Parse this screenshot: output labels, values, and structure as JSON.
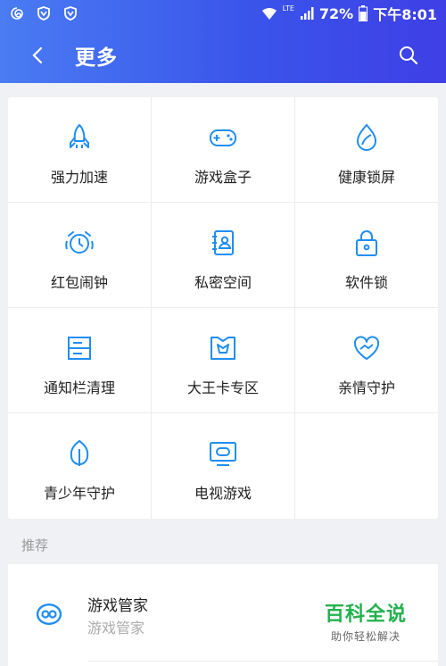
{
  "status_bar": {
    "battery": "72%",
    "time": "下午8:01",
    "network": "LTE",
    "icons": [
      "swirl-icon",
      "shield-icon",
      "shield-icon",
      "wifi-icon",
      "signal-icon",
      "battery-icon"
    ]
  },
  "toolbar": {
    "title": "更多",
    "back_icon": "chevron-left-icon",
    "search_icon": "search-icon"
  },
  "colors": {
    "header_start": "#4a7cf3",
    "header_end": "#3f3fe6",
    "icon_blue": "#1f8ef1",
    "brand_green": "#22b14c"
  },
  "grid": {
    "items": [
      {
        "label": "强力加速",
        "icon": "rocket-icon"
      },
      {
        "label": "游戏盒子",
        "icon": "gamepad-icon"
      },
      {
        "label": "健康锁屏",
        "icon": "leaf-drop-icon"
      },
      {
        "label": "红包闹钟",
        "icon": "alarm-clock-icon"
      },
      {
        "label": "私密空间",
        "icon": "contact-book-icon"
      },
      {
        "label": "软件锁",
        "icon": "lock-icon"
      },
      {
        "label": "通知栏清理",
        "icon": "notification-bar-icon"
      },
      {
        "label": "大王卡专区",
        "icon": "king-card-icon"
      },
      {
        "label": "亲情守护",
        "icon": "heart-hand-icon"
      },
      {
        "label": "青少年守护",
        "icon": "sprout-leaf-icon"
      },
      {
        "label": "电视游戏",
        "icon": "tv-game-icon"
      }
    ]
  },
  "recommend": {
    "section_label": "推荐",
    "items": [
      {
        "title": "游戏管家",
        "subtitle": "游戏管家",
        "icon": "game-manager-icon"
      }
    ]
  },
  "watermark": {
    "brand": "百科全说",
    "tagline": "助你轻松解决"
  }
}
